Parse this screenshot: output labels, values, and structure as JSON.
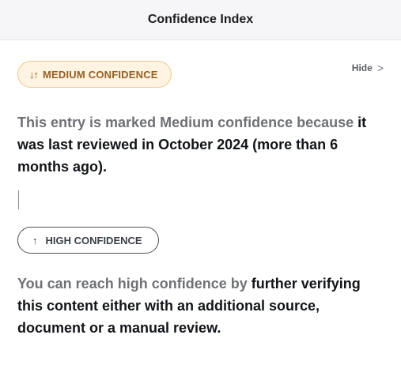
{
  "header": {
    "title": "Confidence Index"
  },
  "medium_badge": {
    "icon": "sort-arrows-icon",
    "label": "MEDIUM CONFIDENCE",
    "glyph": "↓↑"
  },
  "hide": {
    "label": "Hide",
    "glyph": ">"
  },
  "medium_text": {
    "part1": "This entry is marked Medium confidence because",
    "part2": " it was last reviewed in October 2024 (more than 6 months ago)."
  },
  "high_badge": {
    "icon": "arrow-up-icon",
    "label": "HIGH CONFIDENCE",
    "glyph": "↑"
  },
  "high_text": {
    "part1": "You can reach high confidence by",
    "part2": " further verifying this content either with an additional source, document or a manual review."
  },
  "colors": {
    "medium_badge_bg": "#fff3e1",
    "medium_badge_border": "#f0c88f",
    "medium_badge_text": "#946024",
    "muted_text": "#6f7177",
    "dark_text": "#111418"
  }
}
